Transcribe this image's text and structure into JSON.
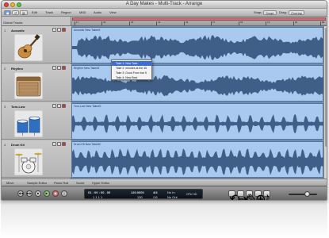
{
  "window": {
    "title": "A Day Makes - Multi-Track - Arrange"
  },
  "toolbar": {
    "left_buttons": [
      "◼",
      "↺",
      "▤"
    ],
    "menus": [
      "Edit",
      "Track",
      "Region",
      "MIDI",
      "Audio",
      "View"
    ],
    "right_buttons": [
      "Snap:",
      "Smart",
      "Drag:",
      "Overlap"
    ]
  },
  "global_tracks_label": "Global Tracks",
  "ruler": {
    "marks": [
      "17",
      "25",
      "33",
      "41",
      "49",
      "57",
      "65",
      "73",
      "81",
      "89"
    ]
  },
  "tracks": [
    {
      "num": "1",
      "name": "Acoustic",
      "icon": "acoustic-guitar-icon",
      "region": "Acoustic New Take#4"
    },
    {
      "num": "2",
      "name": "Rhythm",
      "icon": "amplifier-icon",
      "region": "Rhythm New Take#3"
    },
    {
      "num": "3",
      "name": "Tom-Low",
      "icon": "drums-icon",
      "region": "Tom-Low New Take#3"
    },
    {
      "num": "4",
      "name": "Drum Kit",
      "icon": "drum-kit-icon",
      "region": "Drum Kit New Take#2"
    }
  ],
  "take_menu": {
    "items": [
      "Take 1: New Take",
      "Take 2: minutes at the 45",
      "Take 3: Good From bar 5",
      "Take 4: New Best"
    ],
    "selected_index": 0
  },
  "bottom_tabs": [
    "Mixer",
    "Sample Editor",
    "Piano Roll",
    "Score",
    "Hyper Editor"
  ],
  "transport": {
    "buttons": [
      "◀◀",
      "▶▶",
      "■",
      "▶",
      "●",
      "||"
    ],
    "lcd": {
      "smpte": "01 : 00 : 00 . 00",
      "bars": "1   1   1   1",
      "bpm": "120.0000",
      "position_sub": "130",
      "sig_top": "4/4",
      "sig_sub": "/16",
      "in": "No In",
      "out": "No Out",
      "cpu_label": "CPU HD"
    },
    "right_buttons": [
      "⟲",
      "⇥",
      "✎",
      "⊕",
      "♪"
    ]
  },
  "colors": {
    "region": "#a9c9ee",
    "waveform": "#3f5f88",
    "cycle": "#c4707a",
    "record": "#c23b3b"
  }
}
